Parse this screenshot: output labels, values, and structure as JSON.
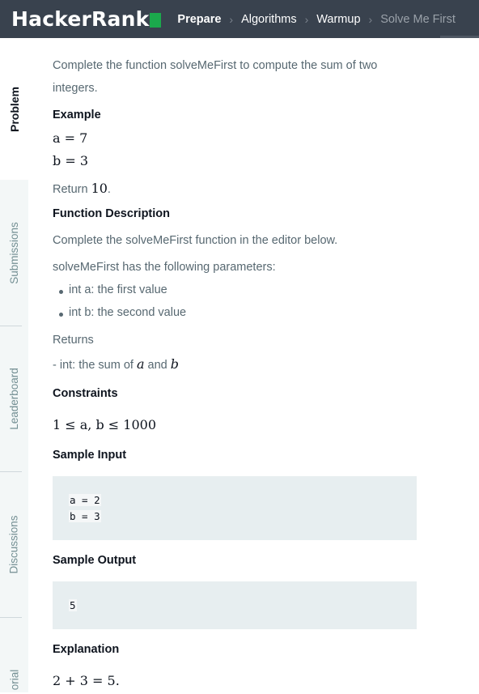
{
  "header": {
    "logo_text": "HackerRank",
    "breadcrumbs": [
      "Prepare",
      "Algorithms",
      "Warmup",
      "Solve Me First"
    ]
  },
  "sidebar": {
    "tabs": [
      "Problem",
      "Submissions",
      "Leaderboard",
      "Discussions",
      "orial"
    ]
  },
  "problem": {
    "intro_line1": "Complete the function solveMeFirst to compute the sum of two",
    "intro_line2": "integers.",
    "example_heading": "Example",
    "example_a": "a = 7",
    "example_b": "b = 3",
    "return_prefix": "Return ",
    "return_value": "10",
    "return_suffix": ".",
    "function_description_heading": "Function Description",
    "function_description_text": "Complete the solveMeFirst function in the editor below.",
    "parameters_text": "solveMeFirst has the following parameters:",
    "params": [
      "int a: the first value",
      "int b: the second value"
    ],
    "returns_heading": "Returns",
    "returns_prefix": "- int: the sum of ",
    "returns_var_a": "a",
    "returns_and": " and ",
    "returns_var_b": "b",
    "constraints_heading": "Constraints",
    "constraint": "1 ≤ a, b ≤ 1000",
    "sample_input_heading": "Sample Input",
    "sample_input_lines": [
      "a = 2",
      "b = 3"
    ],
    "sample_output_heading": "Sample Output",
    "sample_output": "5",
    "explanation_heading": "Explanation",
    "explanation": "2 + 3 = 5."
  }
}
